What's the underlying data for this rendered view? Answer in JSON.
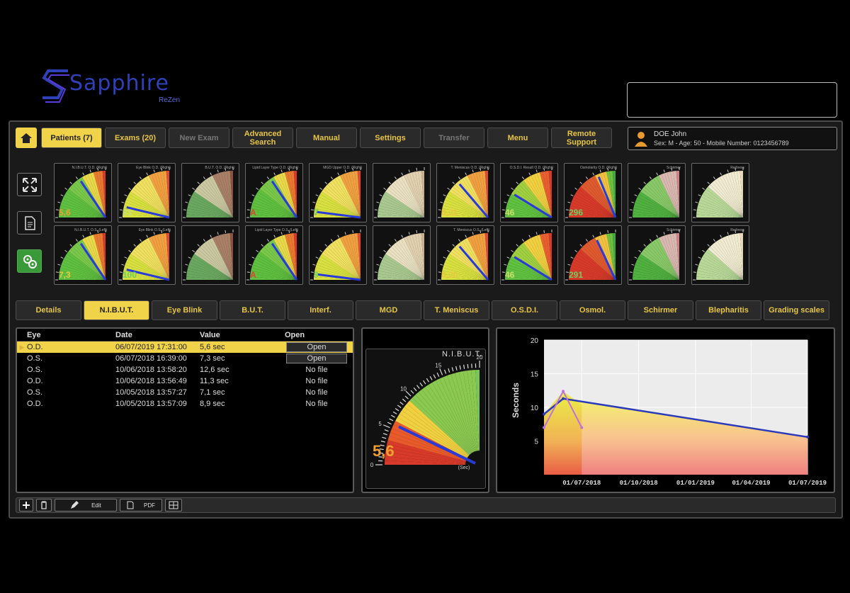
{
  "logo": {
    "word": "Sapphire",
    "sub": "ReZen"
  },
  "nav": {
    "buttons": [
      {
        "label": "Patients (7)",
        "state": "active"
      },
      {
        "label": "Exams (20)",
        "state": "normal"
      },
      {
        "label": "New Exam",
        "state": "disabled"
      },
      {
        "label": "Advanced Search",
        "state": "normal"
      },
      {
        "label": "Manual",
        "state": "normal"
      },
      {
        "label": "Settings",
        "state": "normal"
      },
      {
        "label": "Transfer",
        "state": "disabled"
      },
      {
        "label": "Menu",
        "state": "normal"
      },
      {
        "label": "Remote Support",
        "state": "normal"
      }
    ]
  },
  "patient": {
    "name": "DOE John",
    "info": "Sex: M - Age: 50 - Mobile Number: 0123456789"
  },
  "tiles": [
    {
      "label": "N.I.B.U.T. O.D. (Right)",
      "value": "5,6",
      "color": "#f0a030",
      "scheme": "green",
      "needle": 0.62
    },
    {
      "label": "Eye Blink O.D. (Right)",
      "value": "88",
      "color": "#c8e06a",
      "scheme": "yellow",
      "needle": 0.15
    },
    {
      "label": "B.U.T. O.D. (Right)",
      "value": "",
      "color": "#ccc",
      "scheme": "brown",
      "needle": null
    },
    {
      "label": "Lipid Layer Type O.D. (Right)",
      "value": "A",
      "color": "#e04030",
      "scheme": "green",
      "needle": 0.62
    },
    {
      "label": "MGD Upper O.D. (Right)",
      "value": "7",
      "color": "#6ad060",
      "scheme": "yellow",
      "needle": 0.08
    },
    {
      "label": "",
      "value": "",
      "color": "#ccc",
      "scheme": "beige",
      "needle": null
    },
    {
      "label": "T. Meniscus O.D. (Right)",
      "value": "0,21",
      "color": "#e8c840",
      "scheme": "yellow",
      "needle": 0.55
    },
    {
      "label": "O.S.D.I. Result O.D. (Right)",
      "value": "46",
      "color": "#c8e06a",
      "scheme": "greenred",
      "needle": 0.35
    },
    {
      "label": "Osmolarity O.D. (Right)",
      "value": "296",
      "color": "#6ad060",
      "scheme": "red",
      "needle": 0.75
    },
    {
      "label": "Schirmer",
      "value": "",
      "color": "#ccc",
      "scheme": "greenpink",
      "needle": null
    },
    {
      "label": "Redness",
      "value": "",
      "color": "#ccc",
      "scheme": "beige2",
      "needle": null
    },
    {
      "label": "N.I.B.U.T. O.S. (Left)",
      "value": "7,3",
      "color": "#e8c840",
      "scheme": "green",
      "needle": 0.62
    },
    {
      "label": "Eye Blink O.S. (Left)",
      "value": "100",
      "color": "#6ad060",
      "scheme": "yellow",
      "needle": 0.15
    },
    {
      "label": "",
      "value": "",
      "color": "#ccc",
      "scheme": "brown",
      "needle": null
    },
    {
      "label": "Lipid Layer Type O.S. (Left)",
      "value": "A",
      "color": "#e04030",
      "scheme": "green",
      "needle": 0.62
    },
    {
      "label": "",
      "value": "9",
      "color": "#6ad060",
      "scheme": "yellow",
      "needle": 0.08
    },
    {
      "label": "",
      "value": "",
      "color": "#ccc",
      "scheme": "beige",
      "needle": null
    },
    {
      "label": "T. Meniscus O.S. (Left)",
      "value": "0,20",
      "color": "#e8c840",
      "scheme": "yellow",
      "needle": 0.55
    },
    {
      "label": "",
      "value": "46",
      "color": "#c8e06a",
      "scheme": "greenred",
      "needle": 0.35
    },
    {
      "label": "",
      "value": "291",
      "color": "#6ad060",
      "scheme": "red",
      "needle": 0.72
    },
    {
      "label": "Schirmer",
      "value": "",
      "color": "#ccc",
      "scheme": "greenpink",
      "needle": null
    },
    {
      "label": "Redness",
      "value": "",
      "color": "#ccc",
      "scheme": "beige2",
      "needle": null
    }
  ],
  "tabs": [
    {
      "label": "Details",
      "active": false
    },
    {
      "label": "N.I.B.U.T.",
      "active": true
    },
    {
      "label": "Eye Blink",
      "active": false
    },
    {
      "label": "B.U.T.",
      "active": false
    },
    {
      "label": "Interf.",
      "active": false
    },
    {
      "label": "MGD",
      "active": false
    },
    {
      "label": "T. Meniscus",
      "active": false
    },
    {
      "label": "O.S.D.I.",
      "active": false
    },
    {
      "label": "Osmol.",
      "active": false
    },
    {
      "label": "Schirmer",
      "active": false
    },
    {
      "label": "Blepharitis",
      "active": false
    },
    {
      "label": "Grading scales",
      "active": false
    }
  ],
  "table": {
    "headers": [
      "Eye",
      "Date",
      "Value",
      "Open"
    ],
    "rows": [
      {
        "eye": "O.D.",
        "date": "06/07/2019 17:31:00",
        "value": "5,6 sec",
        "open": "Open",
        "selected": true,
        "button": true
      },
      {
        "eye": "O.S.",
        "date": "06/07/2018 16:39:00",
        "value": "7,3 sec",
        "open": "Open",
        "selected": false,
        "button": true
      },
      {
        "eye": "O.S.",
        "date": "10/06/2018 13:58:20",
        "value": "12,6 sec",
        "open": "No file",
        "selected": false,
        "button": false
      },
      {
        "eye": "O.D.",
        "date": "10/06/2018 13:56:49",
        "value": "11,3 sec",
        "open": "No file",
        "selected": false,
        "button": false
      },
      {
        "eye": "O.S.",
        "date": "10/05/2018 13:57:27",
        "value": "7,1 sec",
        "open": "No file",
        "selected": false,
        "button": false
      },
      {
        "eye": "O.D.",
        "date": "10/05/2018 13:57:09",
        "value": "8,9 sec",
        "open": "No file",
        "selected": false,
        "button": false
      }
    ]
  },
  "gauge": {
    "title": "N.I.B.U.T.",
    "value": "5,6",
    "value_num": 5.6,
    "max": 20,
    "unit": "(Sec)",
    "ticks": [
      "20",
      "15",
      "10",
      "5",
      "0"
    ]
  },
  "chart_data": {
    "type": "line",
    "ylabel": "Seconds",
    "xlabel": "",
    "ylim": [
      0,
      20
    ],
    "yticks": [
      5,
      10,
      15,
      20
    ],
    "xticks": [
      "01/07/2018",
      "01/10/2018",
      "01/01/2019",
      "01/04/2019",
      "01/07/2019"
    ],
    "series": [
      {
        "name": "",
        "color": "#2a3ab8",
        "x": [
          "01/05/2018",
          "01/06/2018",
          "01/07/2019"
        ],
        "y": [
          9,
          11.3,
          5.6
        ]
      },
      {
        "name": "",
        "color": "#c070e0",
        "x": [
          "01/05/2018",
          "01/06/2018",
          "01/07/2018"
        ],
        "y": [
          7,
          12.4,
          7
        ]
      }
    ]
  },
  "bottom": {
    "edit": "Edit",
    "pdf": "PDF"
  }
}
